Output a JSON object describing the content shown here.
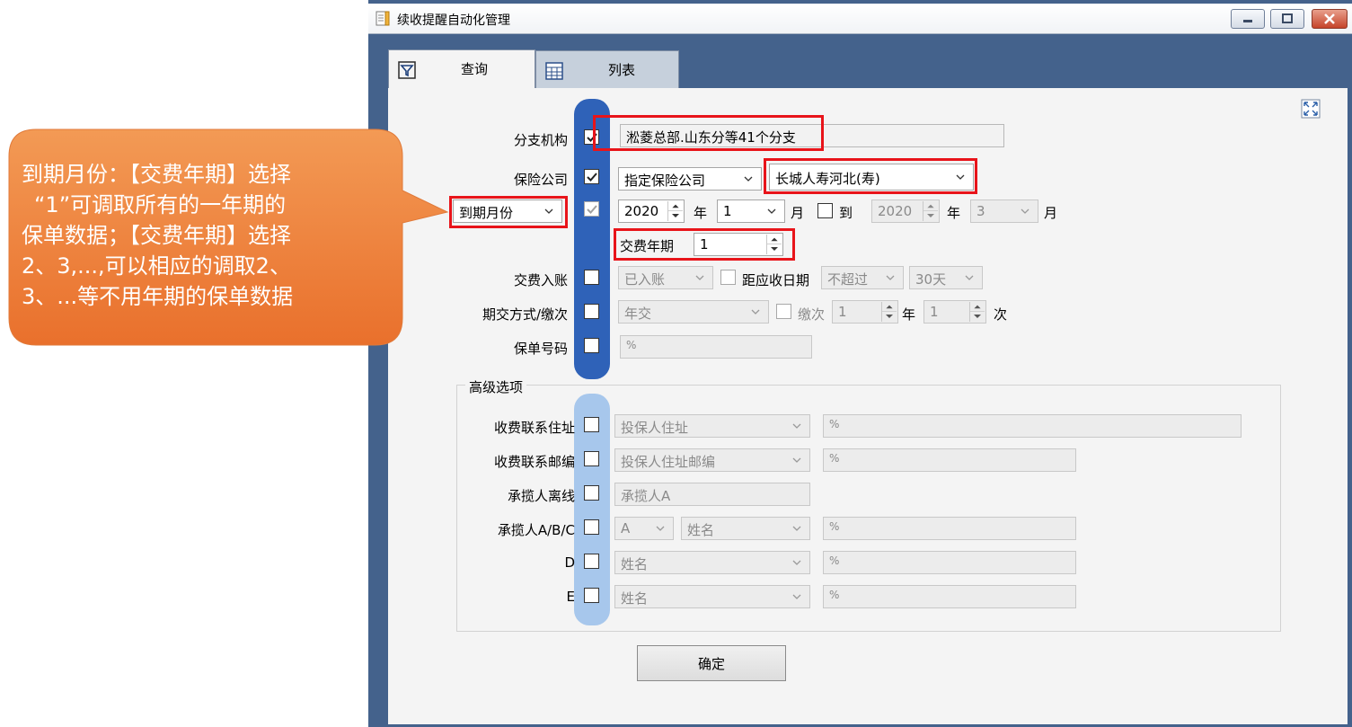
{
  "window": {
    "title": "续收提醒自动化管理"
  },
  "tabs": [
    {
      "label": "查询"
    },
    {
      "label": "列表"
    }
  ],
  "form": {
    "branch": {
      "label": "分支机构",
      "value": "淞菱总部.山东分等41个分支"
    },
    "insurer": {
      "label": "保险公司",
      "mode": "指定保险公司",
      "value": "长城人寿河北(寿)"
    },
    "due": {
      "label_select": "到期月份",
      "from_year": "2020",
      "year_unit": "年",
      "from_month": "1",
      "month_unit": "月",
      "to_label": "到",
      "to_year": "2020",
      "to_month": "3"
    },
    "pay_period": {
      "label": "交费年期",
      "value": "1"
    },
    "payment_entry": {
      "label": "交费入账",
      "value": "已入账",
      "due_label": "距应收日期",
      "limit": "不超过",
      "days": "30天"
    },
    "pay_mode": {
      "label": "期交方式/缴次",
      "value": "年交",
      "count_label": "缴次",
      "count_value": "1",
      "year_unit": "年",
      "times_value": "1",
      "times_unit": "次"
    },
    "policy_no": {
      "label": "保单号码",
      "placeholder": "%"
    }
  },
  "advanced": {
    "title": "高级选项",
    "rows": [
      {
        "label": "收费联系住址",
        "select": "投保人住址",
        "value": "%"
      },
      {
        "label": "收费联系邮编",
        "select": "投保人住址邮编",
        "value": "%"
      },
      {
        "label": "承揽人离线",
        "select": "承揽人A"
      },
      {
        "label": "承揽人A/B/C",
        "select_a": "A",
        "select": "姓名",
        "value": "%"
      },
      {
        "label": "D",
        "select": "姓名",
        "value": "%"
      },
      {
        "label": "E",
        "select": "姓名",
        "value": "%"
      }
    ]
  },
  "confirm_label": "确定",
  "callout": {
    "lines": [
      "到期月份：【交费年期】选择",
      "“1”可调取所有的一年期的",
      "保单数据；【交费年期】选择",
      "2、3,...,可以相应的调取2、",
      "3、...等不用年期的保单数据"
    ]
  },
  "colors": {
    "window_bg": "#44628c",
    "panel_bg": "#f4f4f4",
    "pill_primary": "#2f62b8",
    "pill_advanced": "#a7c7ec",
    "highlight": "#e8141a",
    "callout": "#ee7a35"
  }
}
